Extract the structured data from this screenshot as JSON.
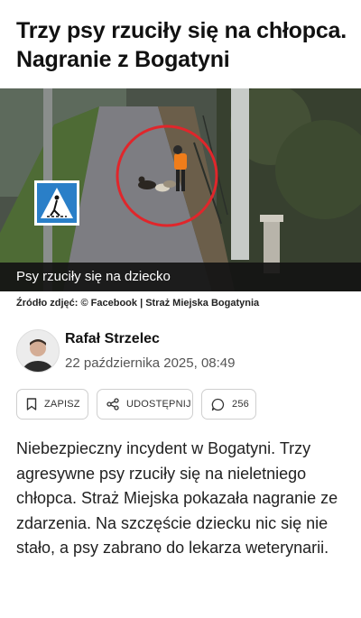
{
  "article": {
    "headline": "Trzy psy rzuciły się na chłopca. Nagranie z Bogatyni",
    "image_caption": "Psy rzuciły się na dziecko",
    "image_source": "Źródło zdjęć: © Facebook | Straż Miejska Bogatynia",
    "author_name": "Rafał Strzelec",
    "date": "22 października 2025, 08:49",
    "body": "Niebezpieczny incydent w Bogatyni. Trzy agresywne psy rzuciły się na nieletniego chłopca. Straż Miejska pokazała nagranie ze zdarzenia. Na szczęście dziecku nic się nie stało, a psy zabrano do lekarza weterynarii."
  },
  "actions": {
    "save_label": "ZAPISZ",
    "share_label": "UDOSTĘPNIJ",
    "comments_count": "256"
  },
  "icons": {
    "save": "bookmark-icon",
    "share": "share-icon",
    "comments": "comment-icon"
  },
  "colors": {
    "highlight_circle": "#e0262b",
    "caption_bg": "#141414",
    "crossing_sign": "#2a7fc8"
  }
}
